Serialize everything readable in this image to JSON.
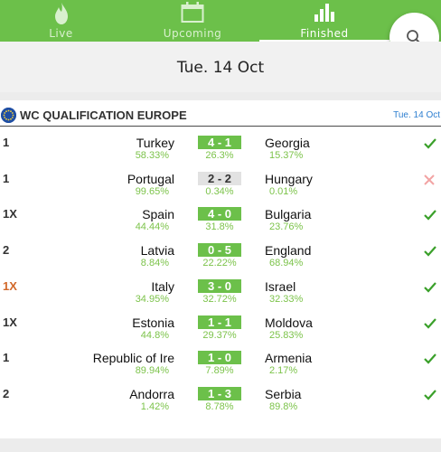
{
  "tabs": [
    {
      "label": "Live",
      "icon": "flame-icon",
      "active": false
    },
    {
      "label": "Upcoming",
      "icon": "calendar-icon",
      "active": false
    },
    {
      "label": "Finished",
      "icon": "bar-chart-icon",
      "active": true
    }
  ],
  "date_header": "Tue. 14 Oct",
  "league": {
    "name": "WC QUALIFICATION EUROPE",
    "date": "Tue. 14 Oct",
    "flag_icon": "eu-flag-icon"
  },
  "matches": [
    {
      "tip": "1",
      "home": "Turkey",
      "home_pct": "58.33%",
      "score": "4 - 1",
      "draw_pct": "26.3%",
      "away": "Georgia",
      "away_pct": "15.37%",
      "result": "correct"
    },
    {
      "tip": "1",
      "home": "Portugal",
      "home_pct": "99.65%",
      "score": "2 - 2",
      "draw_pct": "0.34%",
      "away": "Hungary",
      "away_pct": "0.01%",
      "result": "wrong"
    },
    {
      "tip": "1X",
      "home": "Spain",
      "home_pct": "44.44%",
      "score": "4 - 0",
      "draw_pct": "31.8%",
      "away": "Bulgaria",
      "away_pct": "23.76%",
      "result": "correct"
    },
    {
      "tip": "2",
      "home": "Latvia",
      "home_pct": "8.84%",
      "score": "0 - 5",
      "draw_pct": "22.22%",
      "away": "England",
      "away_pct": "68.94%",
      "result": "correct"
    },
    {
      "tip": "1X",
      "home": "Italy",
      "home_pct": "34.95%",
      "score": "3 - 0",
      "draw_pct": "32.72%",
      "away": "Israel",
      "away_pct": "32.33%",
      "result": "correct",
      "tip_highlight": true
    },
    {
      "tip": "1X",
      "home": "Estonia",
      "home_pct": "44.8%",
      "score": "1 - 1",
      "draw_pct": "29.37%",
      "away": "Moldova",
      "away_pct": "25.83%",
      "result": "correct"
    },
    {
      "tip": "1",
      "home": "Republic of Ire",
      "home_pct": "89.94%",
      "score": "1 - 0",
      "draw_pct": "7.89%",
      "away": "Armenia",
      "away_pct": "2.17%",
      "result": "correct"
    },
    {
      "tip": "2",
      "home": "Andorra",
      "home_pct": "1.42%",
      "score": "1 - 3",
      "draw_pct": "8.78%",
      "away": "Serbia",
      "away_pct": "89.8%",
      "result": "correct"
    }
  ],
  "colors": {
    "brand_green": "#6cc04a",
    "pct_green": "#7cc34a",
    "correct": "#3aa02a",
    "wrong": "#f2a4a4",
    "tip_highlight": "#d2692b",
    "date_link": "#2e7fd0"
  }
}
